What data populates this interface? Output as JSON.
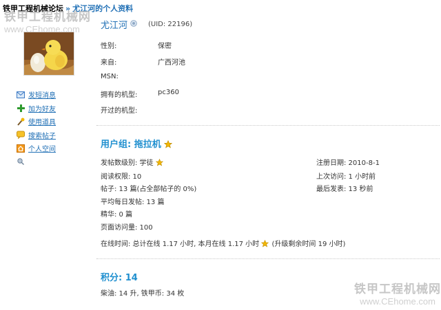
{
  "breadcrumb": {
    "site": "铁甲工程机械论坛",
    "separator": "»",
    "current": "尤江河的个人资料"
  },
  "watermark": {
    "text": "铁甲工程机械网",
    "url": "www.CEhome.com"
  },
  "avatar": {
    "alt": "chick-avatar"
  },
  "side_menu": [
    {
      "icon": "envelope-icon",
      "label": "发短消息"
    },
    {
      "icon": "plus-icon",
      "label": "加为好友"
    },
    {
      "icon": "magic-wand-icon",
      "label": "使用道具"
    },
    {
      "icon": "chat-bubble-icon",
      "label": "搜索帖子"
    },
    {
      "icon": "home-icon",
      "label": "个人空间"
    },
    {
      "icon": "pin-icon",
      "label": ""
    }
  ],
  "profile": {
    "username": "尤江河",
    "uid_text": "(UID: 22196)",
    "fields": [
      {
        "label": "性别:",
        "value": "保密"
      },
      {
        "label": "来自:",
        "value": "广西河池"
      },
      {
        "label": "MSN:",
        "value": ""
      },
      {
        "label": "拥有的机型:",
        "value": "pc360"
      },
      {
        "label": "开过的机型:",
        "value": ""
      }
    ]
  },
  "group": {
    "title": "用户组: 拖拉机"
  },
  "stats_left": [
    "发帖数级别: 学徒",
    "阅读权限: 10",
    "帖子: 13 篇(占全部帖子的 0%)",
    "平均每日发帖: 13 篇",
    "精华: 0 篇",
    "页面访问量: 100"
  ],
  "stats_right": [
    "注册日期: 2010-8-1",
    "上次访问: 1 小时前",
    "最后发表: 13 秒前"
  ],
  "online": {
    "text": "在线时间: 总计在线  1.17 小时, 本月在线  1.17 小时",
    "upgrade": "(升级剩余时间  19 小时)"
  },
  "score": {
    "title": "积分: 14",
    "detail": "柴油: 14 升, 铁甲币: 34 枚"
  },
  "colors": {
    "link": "#1f6fb5",
    "heading": "#1f8fcf",
    "star": "#f2b705"
  }
}
